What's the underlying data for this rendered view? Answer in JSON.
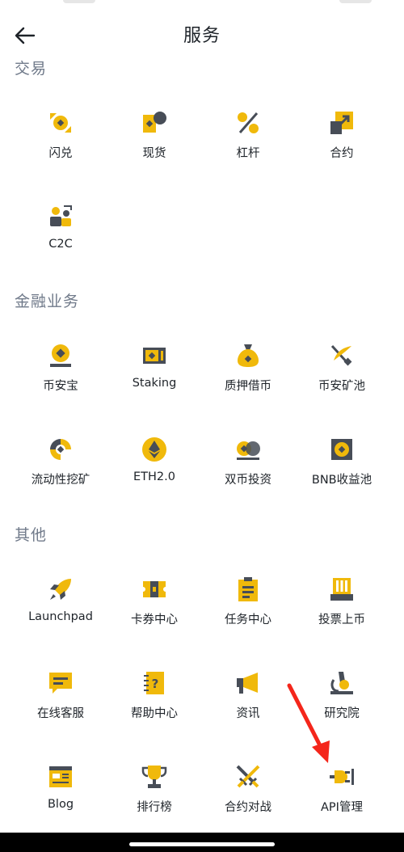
{
  "header": {
    "title": "服务"
  },
  "sections": [
    {
      "title": "交易",
      "items": [
        {
          "label": "闪兑",
          "icon": "convert-icon"
        },
        {
          "label": "现货",
          "icon": "spot-icon"
        },
        {
          "label": "杠杆",
          "icon": "margin-icon"
        },
        {
          "label": "合约",
          "icon": "futures-icon"
        },
        {
          "label": "C2C",
          "icon": "c2c-icon"
        }
      ]
    },
    {
      "title": "金融业务",
      "items": [
        {
          "label": "币安宝",
          "icon": "savings-icon"
        },
        {
          "label": "Staking",
          "icon": "staking-icon"
        },
        {
          "label": "质押借币",
          "icon": "loan-icon"
        },
        {
          "label": "币安矿池",
          "icon": "pool-icon"
        },
        {
          "label": "流动性挖矿",
          "icon": "liquidity-icon"
        },
        {
          "label": "ETH2.0",
          "icon": "eth-icon"
        },
        {
          "label": "双币投资",
          "icon": "dual-investment-icon"
        },
        {
          "label": "BNB收益池",
          "icon": "bnb-vault-icon"
        }
      ]
    },
    {
      "title": "其他",
      "items": [
        {
          "label": "Launchpad",
          "icon": "rocket-icon"
        },
        {
          "label": "卡券中心",
          "icon": "ticket-icon"
        },
        {
          "label": "任务中心",
          "icon": "task-icon"
        },
        {
          "label": "投票上币",
          "icon": "vote-icon"
        },
        {
          "label": "在线客服",
          "icon": "chat-icon"
        },
        {
          "label": "帮助中心",
          "icon": "help-icon"
        },
        {
          "label": "资讯",
          "icon": "news-icon"
        },
        {
          "label": "研究院",
          "icon": "research-icon"
        },
        {
          "label": "Blog",
          "icon": "blog-icon"
        },
        {
          "label": "排行榜",
          "icon": "trophy-icon"
        },
        {
          "label": "合约对战",
          "icon": "battle-icon"
        },
        {
          "label": "API管理",
          "icon": "api-icon"
        }
      ]
    }
  ],
  "colors": {
    "accent": "#F0B90B",
    "icon_dark": "#474D57",
    "section_title": "#707A8A"
  }
}
